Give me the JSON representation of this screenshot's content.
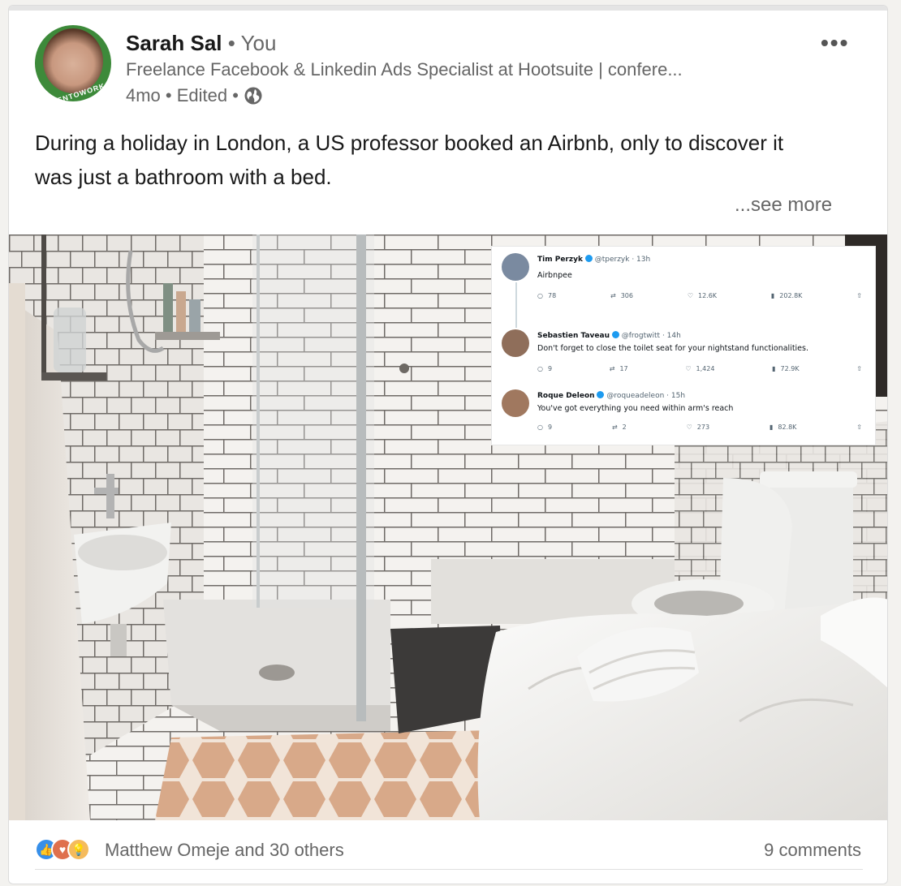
{
  "post": {
    "author": {
      "name": "Sarah Sal",
      "relation": "• You",
      "headline": "Freelance Facebook & Linkedin Ads Specialist at Hootsuite | confere...",
      "meta": "4mo • Edited •",
      "avatar_ring_text": "#OPENTOWORK"
    },
    "more_icon": "more-options-icon",
    "text": "During a holiday in London, a US professor booked an Airbnb, only to discover it was just a bathroom with a bed.",
    "see_more": "...see more",
    "image": {
      "tweets": [
        {
          "name": "Tim Perzyk",
          "handle": "@tperzyk · 13h",
          "text": "Airbnpee",
          "replies": "78",
          "reposts": "306",
          "likes": "12.6K",
          "views": "202.8K"
        },
        {
          "name": "Sebastien Taveau",
          "handle": "@frogtwitt · 14h",
          "text": "Don't forget to close the toilet seat for your nightstand functionalities.",
          "replies": "9",
          "reposts": "17",
          "likes": "1,424",
          "views": "72.9K"
        },
        {
          "name": "Roque Deleon",
          "handle": "@roqueadeleon · 15h",
          "text": "You've got everything you need within arm's reach",
          "replies": "9",
          "reposts": "2",
          "likes": "273",
          "views": "82.8K"
        }
      ]
    },
    "footer": {
      "reactions_text": "Matthew Omeje and 30 others",
      "comments": "9 comments"
    },
    "colors": {
      "like": "#378fe9",
      "love": "#df704d",
      "insightful": "#f5bb5c",
      "opentowork": "#3d8a3a"
    }
  }
}
